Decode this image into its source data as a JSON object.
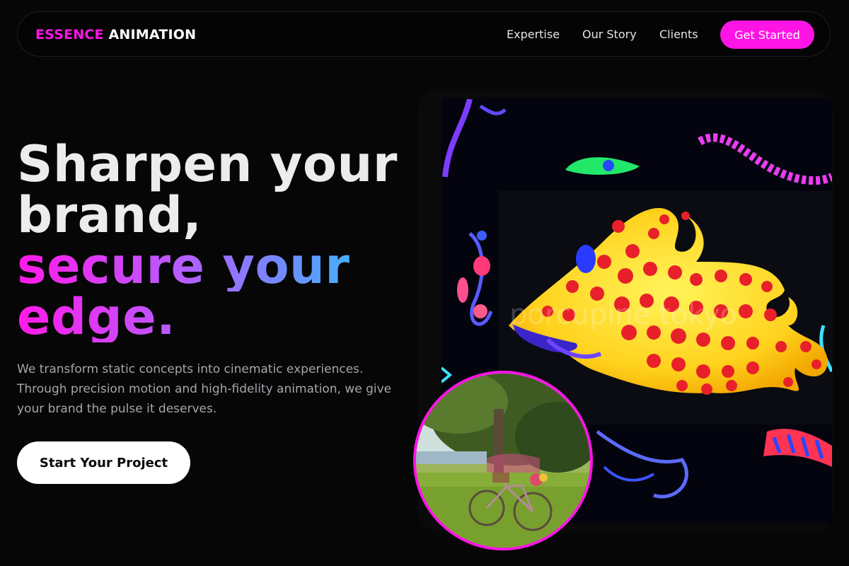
{
  "nav": {
    "logo_accent": "ESSENCE",
    "logo_rest": "ANIMATION",
    "links": [
      "Expertise",
      "Our Story",
      "Clients"
    ],
    "cta_label": "Get Started"
  },
  "hero": {
    "headline_line1": "Sharpen your",
    "headline_line2": "brand,",
    "headline_line3": "secure your",
    "headline_line4": "edge.",
    "subtext": "We transform static concepts into cinematic experiences. Through precision motion and high-fidelity animation, we give your brand the pulse it deserves.",
    "cta_label": "Start Your Project"
  },
  "media": {
    "watermark": "porcupine tokyo"
  },
  "colors": {
    "accent": "#ff14e6",
    "background": "#060606",
    "text": "#ececef",
    "muted": "#a6a6ad"
  }
}
